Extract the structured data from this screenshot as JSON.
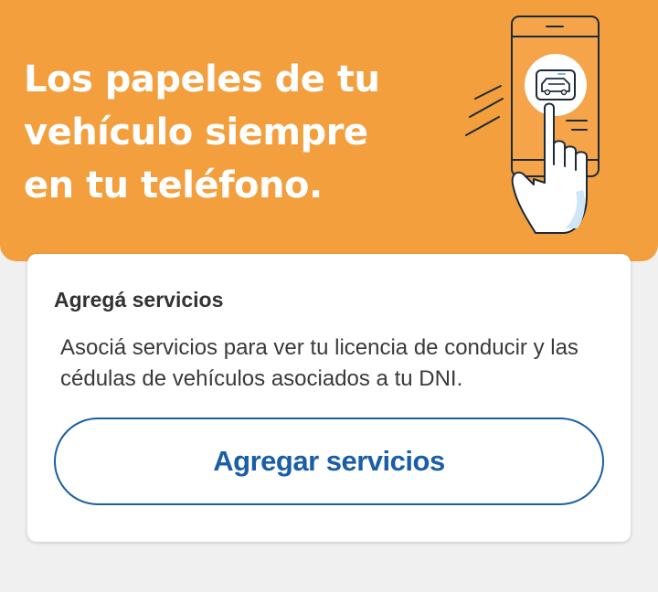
{
  "hero": {
    "title": "Los papeles de tu vehículo siempre en tu teléfono."
  },
  "card": {
    "title": "Agregá servicios",
    "description": "Asociá servicios para ver tu licencia de conducir y las cédulas de vehículos asociados a tu DNI.",
    "button_label": "Agregar servicios"
  },
  "colors": {
    "hero_bg": "#f39f3d",
    "accent": "#1a5ea6",
    "card_bg": "#ffffff",
    "page_bg": "#f0f0f0"
  },
  "icons": {
    "illustration": "phone-with-hand-tapping-car-icon"
  }
}
